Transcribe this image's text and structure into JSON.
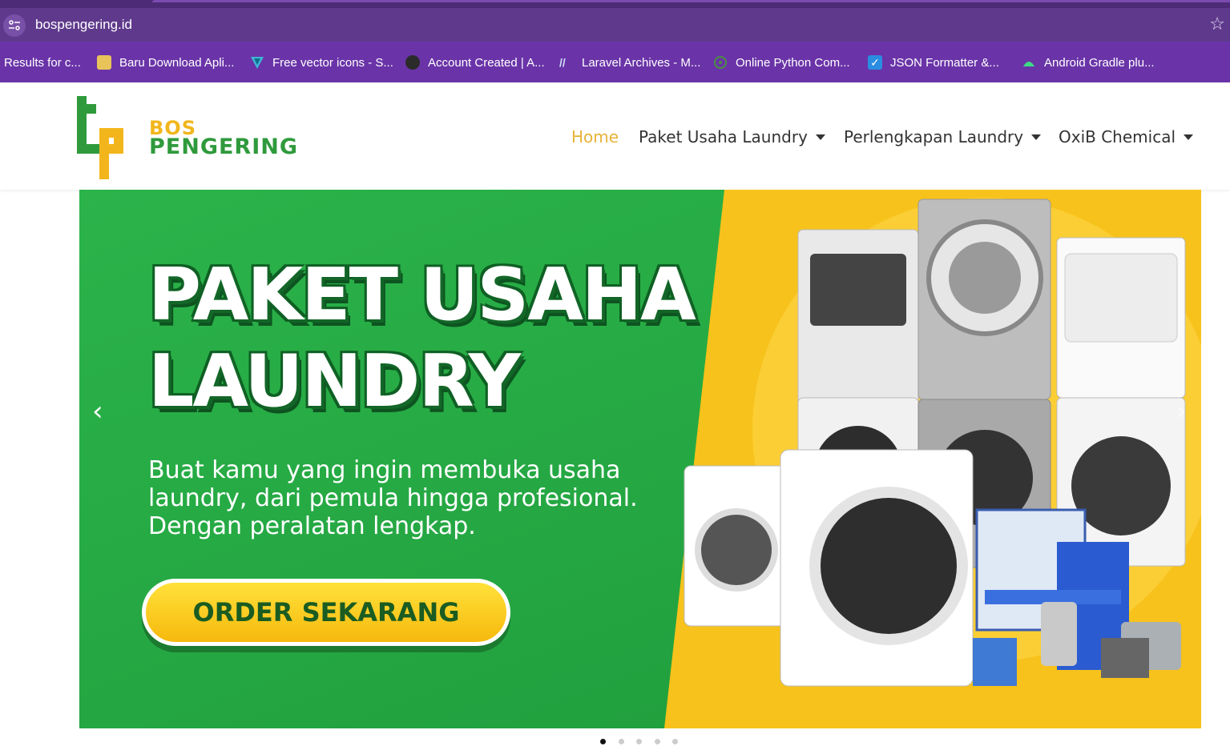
{
  "browser": {
    "url": "bospengering.id",
    "bookmarks": [
      {
        "label": "Results for c...",
        "icon": "none"
      },
      {
        "label": "Baru Download Apli...",
        "icon": "app-icon"
      },
      {
        "label": "Free vector icons - S...",
        "icon": "vector-icon"
      },
      {
        "label": "Account Created | A...",
        "icon": "globe-icon"
      },
      {
        "label": "Laravel Archives - M...",
        "icon": "code-icon"
      },
      {
        "label": "Online Python Com...",
        "icon": "python-icon"
      },
      {
        "label": "JSON Formatter &...",
        "icon": "check-icon"
      },
      {
        "label": "Android Gradle plu...",
        "icon": "android-icon"
      }
    ]
  },
  "site": {
    "logo_line1": "BOS",
    "logo_line2": "PENGERING",
    "nav": [
      {
        "label": "Home",
        "active": true
      },
      {
        "label": "Paket Usaha Laundry",
        "dropdown": true
      },
      {
        "label": "Perlengkapan Laundry",
        "dropdown": true
      },
      {
        "label": "OxiB Chemical",
        "dropdown": true
      }
    ]
  },
  "banner": {
    "headline_1": "PAKET USAHA",
    "headline_2": "LAUNDRY",
    "subtext_1": "Buat kamu yang ingin membuka usaha",
    "subtext_2": "laundry, dari pemula hingga profesional.",
    "subtext_3": "Dengan peralatan lengkap.",
    "cta": "ORDER SEKARANG",
    "prev_arrow": "‹",
    "next_arrow": "›",
    "slides_count": 5,
    "active_slide": 1
  },
  "colors": {
    "chrome_purple": "#6a34a8",
    "brand_green": "#25a843",
    "brand_yellow": "#f7c21b",
    "nav_active": "#e8b23a"
  }
}
